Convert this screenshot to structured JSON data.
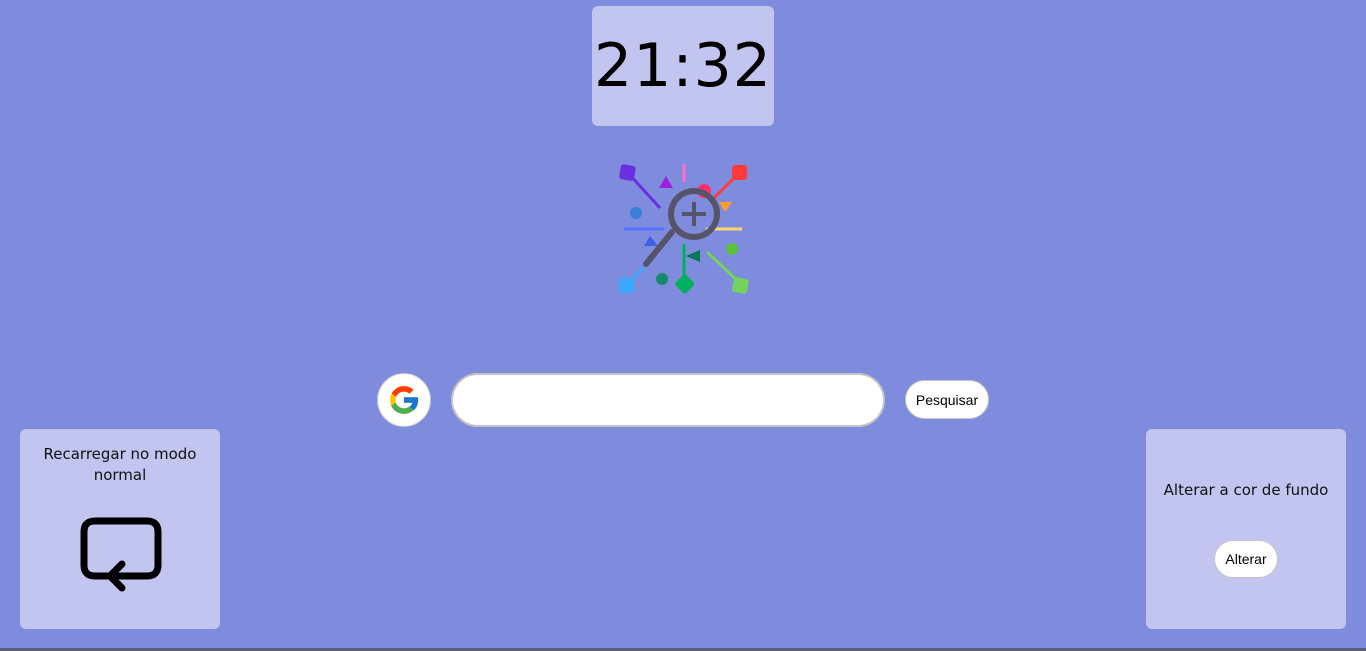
{
  "clock": {
    "time": "21:32"
  },
  "logo": {
    "icon": "search-network-logo-icon"
  },
  "search": {
    "engine_icon": "google-icon",
    "input_value": "",
    "placeholder": "",
    "button_label": "Pesquisar"
  },
  "reload_card": {
    "title": "Recarregar no modo normal",
    "icon": "reload-icon"
  },
  "background_card": {
    "title": "Alterar a cor de fundo",
    "button_label": "Alterar"
  },
  "colors": {
    "background": "#7f8bdd",
    "card": "#c2c5f0",
    "button": "#ffffff"
  }
}
